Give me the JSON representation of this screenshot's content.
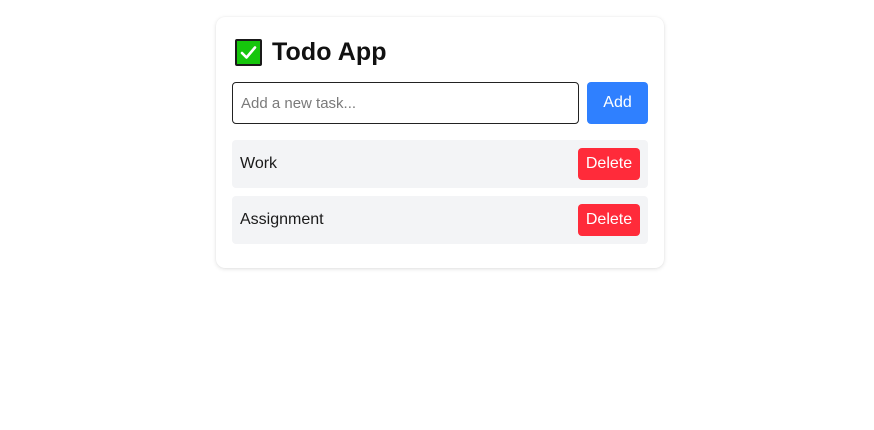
{
  "app": {
    "title": "Todo App",
    "title_icon": "check-mark-button-icon"
  },
  "new_task": {
    "value": "",
    "placeholder": "Add a new task...",
    "add_label": "Add"
  },
  "tasks": [
    {
      "label": "Work",
      "delete_label": "Delete"
    },
    {
      "label": "Assignment",
      "delete_label": "Delete"
    }
  ],
  "colors": {
    "accent": "#2f80ff",
    "danger": "#ff2b3a",
    "check_green": "#16c60c",
    "item_background": "#f3f4f6"
  }
}
